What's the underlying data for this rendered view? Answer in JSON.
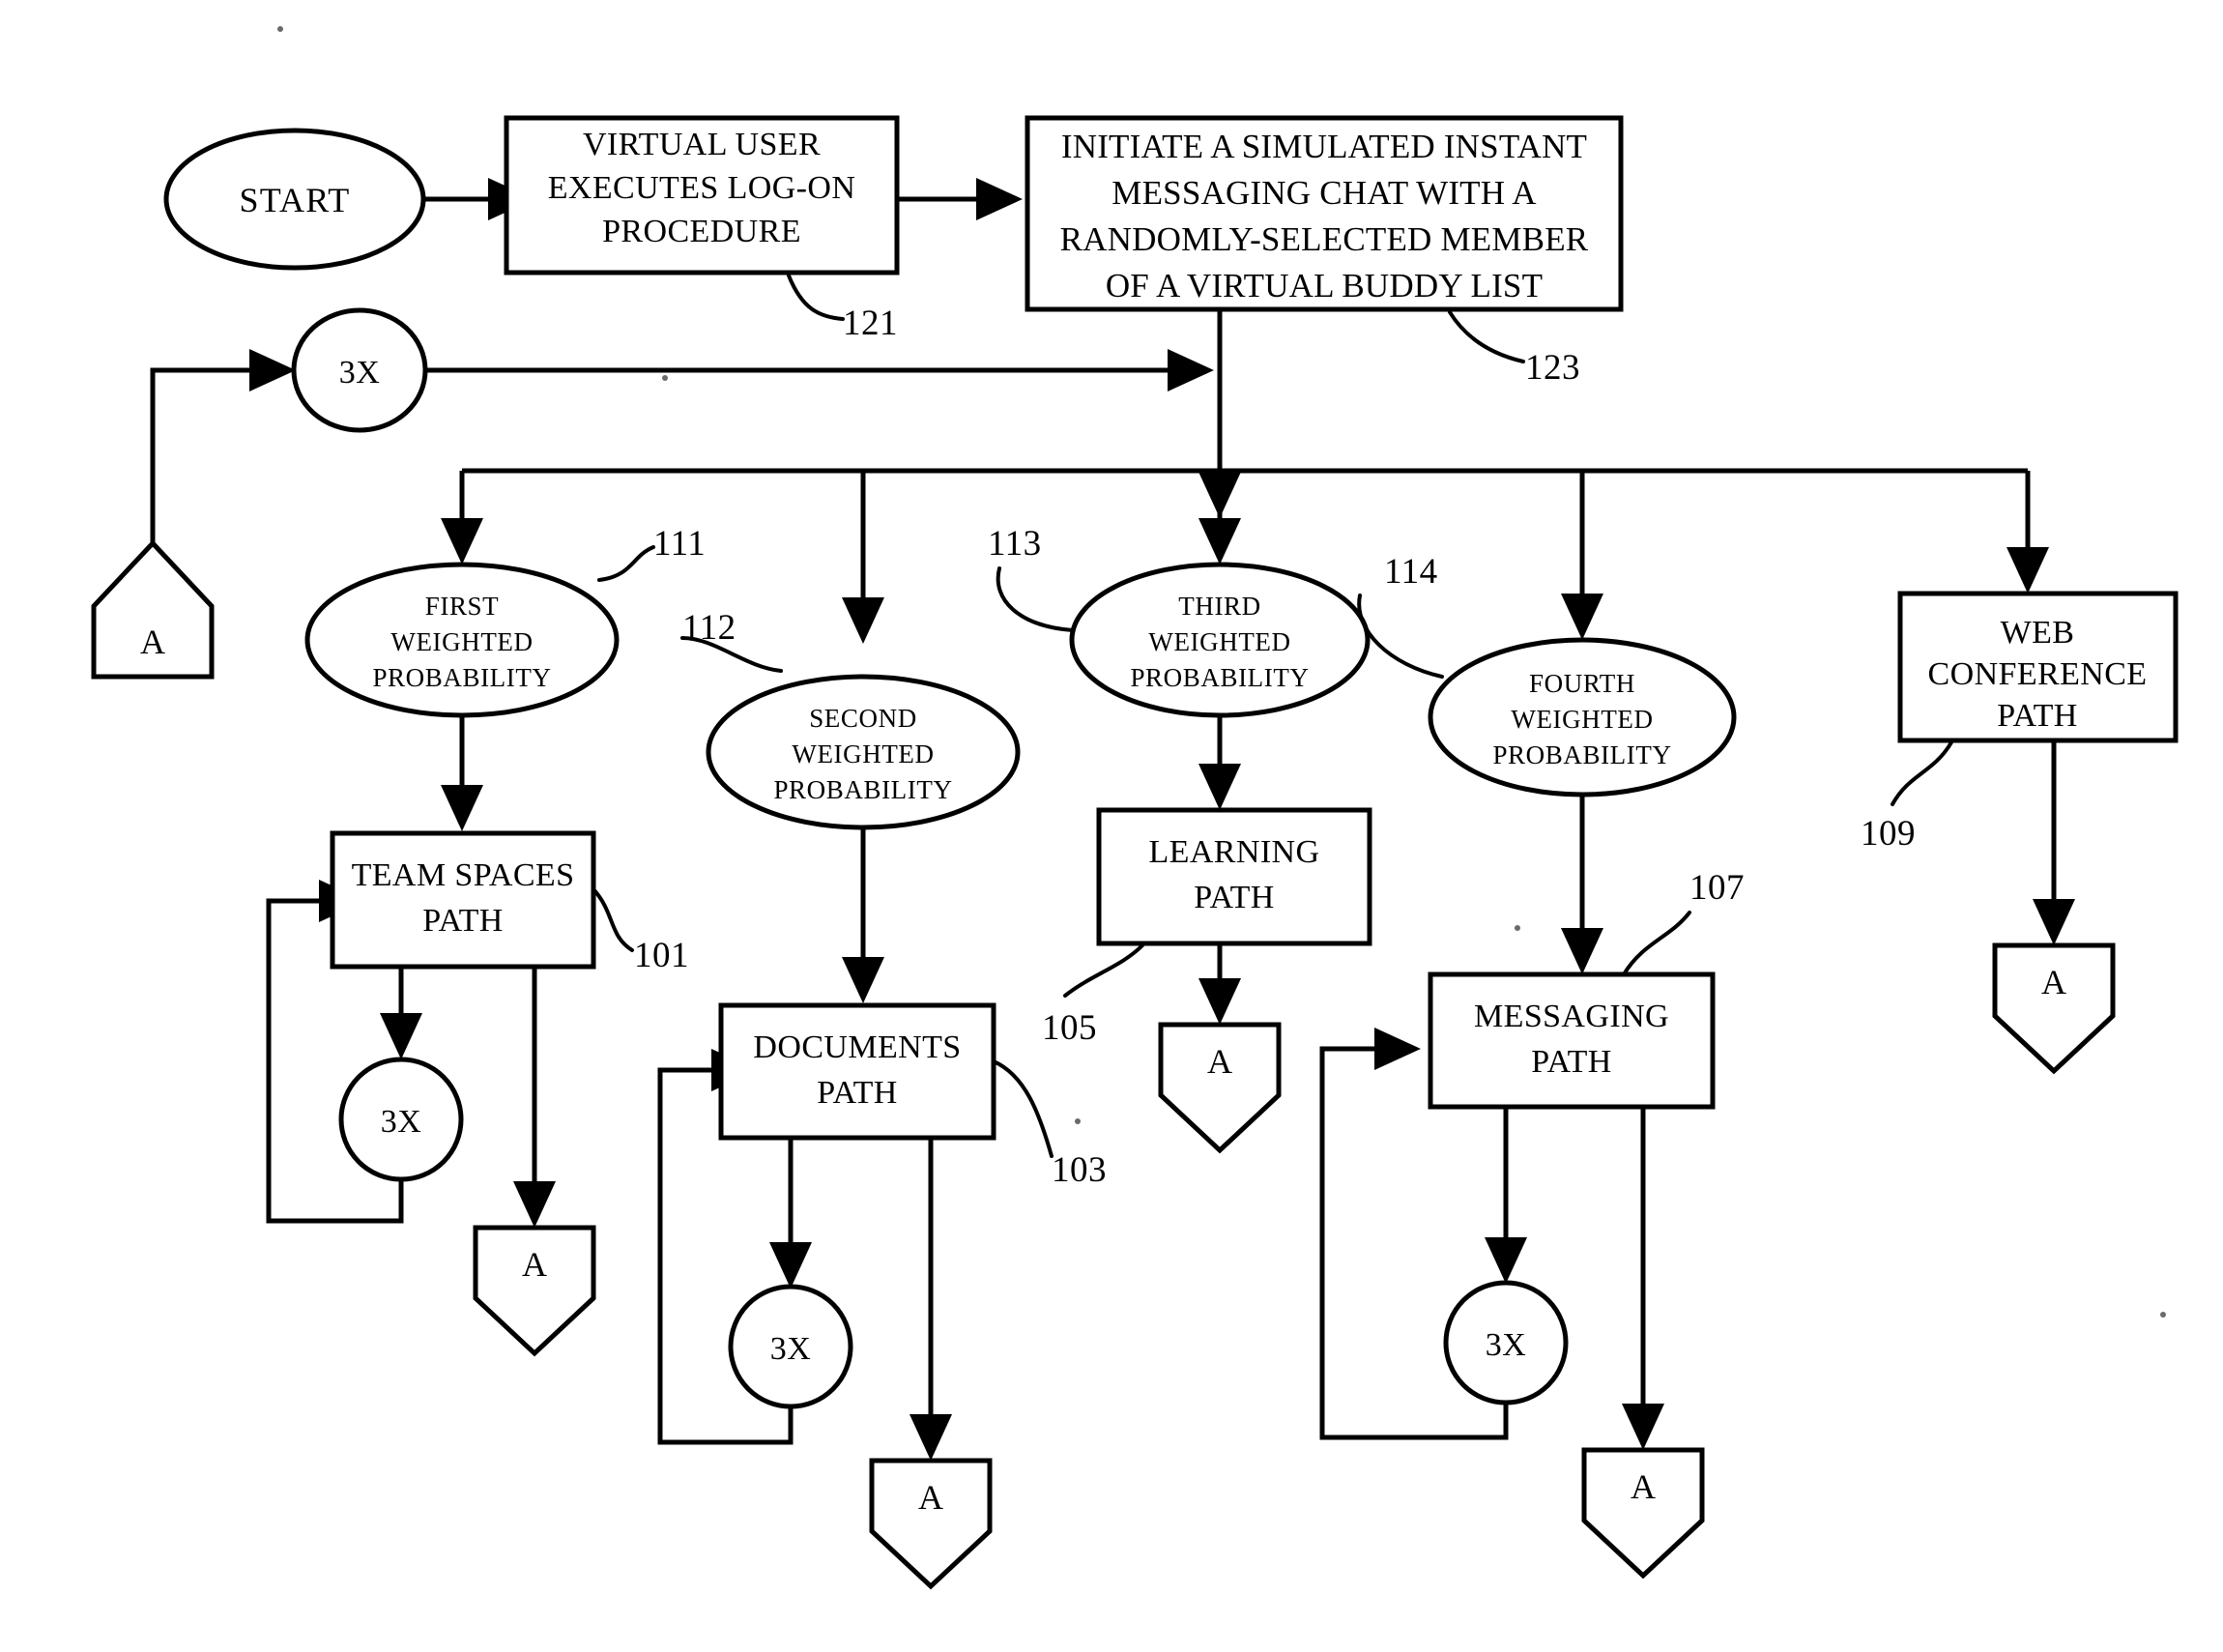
{
  "diagram": {
    "type": "patent-flowchart",
    "title": "Simulated Virtual User Collaboration Activity Flowchart",
    "background_color": "#ffffff",
    "line_color": "#000000"
  },
  "nodes": {
    "start": {
      "label": "START",
      "shape": "ellipse"
    },
    "logon": {
      "shape": "process",
      "lines": [
        "VIRTUAL USER",
        "EXECUTES LOG-ON",
        "PROCEDURE"
      ],
      "ref": "121"
    },
    "initiate_chat": {
      "shape": "process",
      "lines": [
        "INITIATE A SIMULATED  INSTANT",
        "MESSAGING CHAT WITH A",
        "RANDOMLY-SELECTED MEMBER",
        "OF A VIRTUAL BUDDY LIST"
      ],
      "ref": "123"
    },
    "loop_top": {
      "label": "3X",
      "shape": "circle"
    },
    "connector_in_a": {
      "label": "A",
      "shape": "connector-up"
    },
    "first_weighted": {
      "shape": "ellipse",
      "lines": [
        "FIRST",
        "WEIGHTED",
        "PROBABILITY"
      ],
      "ref": "111"
    },
    "second_weighted": {
      "shape": "ellipse",
      "lines": [
        "SECOND",
        "WEIGHTED",
        "PROBABILITY"
      ],
      "ref": "112"
    },
    "third_weighted": {
      "shape": "ellipse",
      "lines": [
        "THIRD",
        "WEIGHTED",
        "PROBABILITY"
      ],
      "ref": "113"
    },
    "fourth_weighted": {
      "shape": "ellipse",
      "lines": [
        "FOURTH",
        "WEIGHTED",
        "PROBABILITY"
      ],
      "ref": "114"
    },
    "team_spaces": {
      "shape": "process",
      "lines": [
        "TEAM SPACES",
        "PATH"
      ],
      "ref": "101"
    },
    "documents": {
      "shape": "process",
      "lines": [
        "DOCUMENTS",
        "PATH"
      ],
      "ref": "103"
    },
    "learning": {
      "shape": "process",
      "lines": [
        "LEARNING",
        "PATH"
      ],
      "ref": "105"
    },
    "messaging": {
      "shape": "process",
      "lines": [
        "MESSAGING",
        "PATH"
      ],
      "ref": "107"
    },
    "web_conference": {
      "shape": "process",
      "lines": [
        "WEB",
        "CONFERENCE",
        "PATH"
      ],
      "ref": "109"
    },
    "loop_team": {
      "label": "3X",
      "shape": "circle"
    },
    "loop_documents": {
      "label": "3X",
      "shape": "circle"
    },
    "loop_messaging": {
      "label": "3X",
      "shape": "circle"
    },
    "exit_team": {
      "label": "A",
      "shape": "connector-down"
    },
    "exit_documents": {
      "label": "A",
      "shape": "connector-down"
    },
    "exit_learning": {
      "label": "A",
      "shape": "connector-down"
    },
    "exit_messaging": {
      "label": "A",
      "shape": "connector-down"
    },
    "exit_web": {
      "label": "A",
      "shape": "connector-down"
    }
  },
  "reference_numerals": {
    "r101": "101",
    "r103": "103",
    "r105": "105",
    "r107": "107",
    "r109": "109",
    "r111": "111",
    "r112": "112",
    "r113": "113",
    "r114": "114",
    "r121": "121",
    "r123": "123"
  }
}
